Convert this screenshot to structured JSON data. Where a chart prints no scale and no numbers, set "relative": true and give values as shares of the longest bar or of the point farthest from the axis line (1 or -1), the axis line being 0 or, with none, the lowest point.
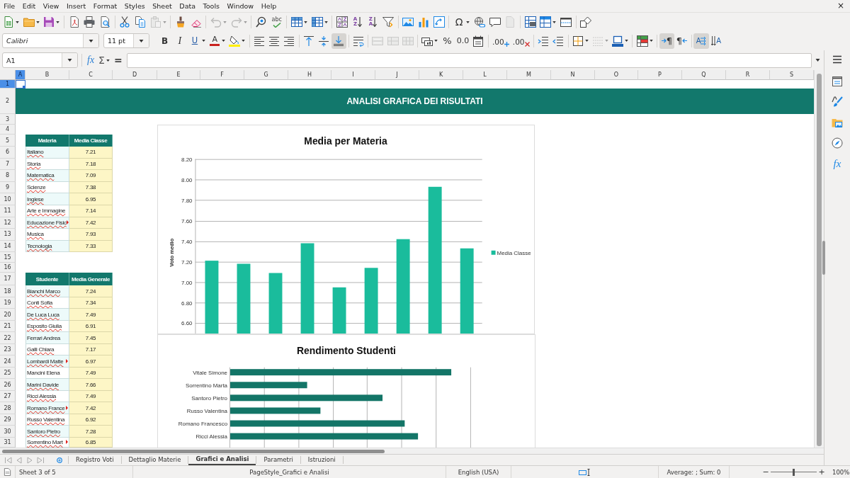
{
  "menu_bar": {
    "items": [
      "File",
      "Edit",
      "View",
      "Insert",
      "Format",
      "Styles",
      "Sheet",
      "Data",
      "Tools",
      "Window",
      "Help"
    ],
    "close": "×"
  },
  "standard_toolbar": {
    "groups": [
      [
        {
          "kind": "new",
          "menu": true,
          "disabled": false
        },
        {
          "kind": "open",
          "menu": true,
          "disabled": false
        },
        {
          "kind": "save",
          "menu": true,
          "disabled": false
        }
      ],
      [
        {
          "kind": "pdf",
          "menu": false,
          "disabled": false
        },
        {
          "kind": "print",
          "menu": false,
          "disabled": false
        },
        {
          "kind": "preview",
          "menu": false,
          "disabled": false
        }
      ],
      [
        {
          "kind": "cut",
          "menu": false,
          "disabled": false
        },
        {
          "kind": "copy",
          "menu": false,
          "disabled": false
        },
        {
          "kind": "paste",
          "menu": true,
          "disabled": true
        }
      ],
      [
        {
          "kind": "clone",
          "menu": false,
          "disabled": false
        },
        {
          "kind": "clear",
          "menu": false,
          "disabled": false
        }
      ],
      [
        {
          "kind": "undo",
          "menu": true,
          "disabled": true
        },
        {
          "kind": "redo",
          "menu": true,
          "disabled": true
        }
      ],
      [
        {
          "kind": "find",
          "menu": false,
          "disabled": false
        },
        {
          "kind": "spelling",
          "text": "abc",
          "menu": false,
          "disabled": false
        }
      ],
      [
        {
          "kind": "rows",
          "menu": true,
          "disabled": false
        },
        {
          "kind": "columns",
          "menu": true,
          "disabled": false
        }
      ],
      [
        {
          "kind": "sort",
          "menu": false,
          "disabled": false
        },
        {
          "kind": "sortup",
          "text": "AZ",
          "menu": false,
          "disabled": false
        },
        {
          "kind": "sortdown",
          "text": "ZA",
          "menu": false,
          "disabled": false
        },
        {
          "kind": "filter",
          "menu": false,
          "disabled": false
        }
      ],
      [
        {
          "kind": "image",
          "menu": false,
          "disabled": false
        },
        {
          "kind": "chart",
          "menu": false,
          "disabled": false
        },
        {
          "kind": "pivot",
          "menu": false,
          "disabled": false
        }
      ],
      [
        {
          "kind": "special",
          "text": "Ω",
          "menu": true,
          "disabled": false
        },
        {
          "kind": "hyperlink",
          "menu": false,
          "disabled": false
        },
        {
          "kind": "comment",
          "menu": false,
          "disabled": false
        },
        {
          "kind": "headerfooter",
          "menu": false,
          "disabled": true
        }
      ],
      [
        {
          "kind": "printarea",
          "menu": false,
          "disabled": false
        },
        {
          "kind": "freeze",
          "menu": true,
          "disabled": false
        },
        {
          "kind": "split",
          "menu": false,
          "disabled": false
        }
      ],
      [
        {
          "kind": "draw",
          "menu": false,
          "disabled": false
        }
      ]
    ]
  },
  "formatting_toolbar": {
    "font_name": "Calibri",
    "font_size": "11 pt",
    "groups": [
      [
        {
          "kind": "bold",
          "text": "B",
          "menu": false,
          "disabled": false,
          "pressed": false
        },
        {
          "kind": "italic",
          "text": "I",
          "menu": false,
          "disabled": false,
          "pressed": false
        },
        {
          "kind": "underline",
          "text": "U",
          "menu": true,
          "disabled": false,
          "pressed": false
        },
        {
          "kind": "fontcolor",
          "text": "A",
          "menu": true,
          "disabled": false,
          "pressed": false
        },
        {
          "kind": "highlight",
          "menu": true,
          "disabled": false,
          "pressed": false
        }
      ],
      [
        {
          "kind": "left",
          "menu": false,
          "disabled": false,
          "pressed": false
        },
        {
          "kind": "center",
          "menu": false,
          "disabled": false,
          "pressed": false
        },
        {
          "kind": "right",
          "menu": false,
          "disabled": false,
          "pressed": false
        }
      ],
      [
        {
          "kind": "top",
          "menu": false,
          "disabled": false,
          "pressed": false
        },
        {
          "kind": "middle",
          "menu": false,
          "disabled": false,
          "pressed": false
        },
        {
          "kind": "bottom",
          "menu": false,
          "disabled": false,
          "pressed": true
        }
      ],
      [
        {
          "kind": "wrap",
          "menu": false,
          "disabled": false,
          "pressed": false
        }
      ],
      [
        {
          "kind": "mergecenter",
          "menu": false,
          "disabled": true,
          "pressed": false
        },
        {
          "kind": "merge",
          "menu": false,
          "disabled": true,
          "pressed": false
        },
        {
          "kind": "unmerge",
          "menu": false,
          "disabled": true,
          "pressed": false
        }
      ],
      [
        {
          "kind": "currency",
          "menu": true,
          "disabled": false,
          "pressed": false
        },
        {
          "kind": "percent",
          "text": "%",
          "menu": false,
          "disabled": false,
          "pressed": false
        },
        {
          "kind": "number",
          "text": "0.0",
          "menu": false,
          "disabled": false,
          "pressed": false
        },
        {
          "kind": "date",
          "menu": false,
          "disabled": false,
          "pressed": false
        }
      ],
      [
        {
          "kind": "adddecimal",
          "text": ".00",
          "menu": false,
          "disabled": false,
          "pressed": false
        },
        {
          "kind": "deldecimal",
          "text": ".00",
          "menu": false,
          "disabled": false,
          "pressed": false
        }
      ],
      [
        {
          "kind": "indent",
          "menu": false,
          "disabled": false,
          "pressed": false
        },
        {
          "kind": "outdent",
          "menu": false,
          "disabled": false,
          "pressed": false
        }
      ],
      [
        {
          "kind": "borders",
          "menu": true,
          "disabled": false,
          "pressed": false
        },
        {
          "kind": "borderstyle",
          "menu": true,
          "disabled": true,
          "pressed": false
        },
        {
          "kind": "bordercolor",
          "menu": true,
          "disabled": false,
          "pressed": false
        }
      ],
      [
        {
          "kind": "conditional",
          "menu": true,
          "disabled": false,
          "pressed": false
        }
      ],
      [
        {
          "kind": "ltr",
          "text": "¶",
          "menu": false,
          "disabled": false,
          "pressed": true
        },
        {
          "kind": "rtl",
          "text": "¶",
          "menu": false,
          "disabled": false,
          "pressed": false
        }
      ],
      [
        {
          "kind": "horizontal",
          "text": "A",
          "menu": false,
          "disabled": false,
          "pressed": true
        },
        {
          "kind": "stacked",
          "text": "A",
          "menu": false,
          "disabled": false,
          "pressed": false
        }
      ]
    ]
  },
  "formula_bar": {
    "name_box": "A1",
    "function_wizard": "fx",
    "sum": "Σ",
    "formula": "="
  },
  "sheet": {
    "columns": [
      {
        "label": "A",
        "selected": true
      },
      {
        "label": "B",
        "selected": false
      },
      {
        "label": "C",
        "selected": false
      },
      {
        "label": "D",
        "selected": false
      },
      {
        "label": "E",
        "selected": false
      },
      {
        "label": "F",
        "selected": false
      },
      {
        "label": "G",
        "selected": false
      },
      {
        "label": "H",
        "selected": false
      },
      {
        "label": "I",
        "selected": false
      },
      {
        "label": "J",
        "selected": false
      },
      {
        "label": "K",
        "selected": false
      },
      {
        "label": "L",
        "selected": false
      },
      {
        "label": "M",
        "selected": false
      },
      {
        "label": "N",
        "selected": false
      },
      {
        "label": "O",
        "selected": false
      },
      {
        "label": "P",
        "selected": false
      },
      {
        "label": "Q",
        "selected": false
      },
      {
        "label": "R",
        "selected": false
      },
      {
        "label": "S",
        "selected": false
      }
    ],
    "rows": [
      {
        "label": "1",
        "selected": true
      },
      {
        "label": "2",
        "selected": false
      },
      {
        "label": "3",
        "selected": false
      },
      {
        "label": "4",
        "selected": false
      },
      {
        "label": "5",
        "selected": false
      },
      {
        "label": "6",
        "selected": false
      },
      {
        "label": "7",
        "selected": false
      },
      {
        "label": "8",
        "selected": false
      },
      {
        "label": "9",
        "selected": false
      },
      {
        "label": "10",
        "selected": false
      },
      {
        "label": "11",
        "selected": false
      },
      {
        "label": "12",
        "selected": false
      },
      {
        "label": "13",
        "selected": false
      },
      {
        "label": "14",
        "selected": false
      },
      {
        "label": "15",
        "selected": false
      },
      {
        "label": "16",
        "selected": false
      },
      {
        "label": "17",
        "selected": false
      },
      {
        "label": "18",
        "selected": false
      },
      {
        "label": "19",
        "selected": false
      },
      {
        "label": "20",
        "selected": false
      },
      {
        "label": "21",
        "selected": false
      },
      {
        "label": "22",
        "selected": false
      },
      {
        "label": "23",
        "selected": false
      },
      {
        "label": "24",
        "selected": false
      },
      {
        "label": "25",
        "selected": false
      },
      {
        "label": "26",
        "selected": false
      },
      {
        "label": "27",
        "selected": false
      },
      {
        "label": "28",
        "selected": false
      },
      {
        "label": "29",
        "selected": false
      },
      {
        "label": "30",
        "selected": false
      },
      {
        "label": "31",
        "selected": false
      }
    ],
    "banner": "ANALISI GRAFICA DEI RISULTATI",
    "subject_table": {
      "columns": [
        "Materia",
        "Media Classe"
      ],
      "rows": [
        {
          "name": "Italiano",
          "value": "7.21",
          "spell_error": true,
          "overflow": false
        },
        {
          "name": "Storia",
          "value": "7.18",
          "spell_error": true,
          "overflow": false
        },
        {
          "name": "Matematica",
          "value": "7.09",
          "spell_error": true,
          "overflow": false
        },
        {
          "name": "Scienze",
          "value": "7.38",
          "spell_error": true,
          "overflow": false
        },
        {
          "name": "Inglese",
          "value": "6.95",
          "spell_error": true,
          "overflow": false
        },
        {
          "name": "Arte e Immagine",
          "value": "7.14",
          "spell_error": true,
          "overflow": false
        },
        {
          "name": "Educazione Fisic",
          "value": "7.42",
          "spell_error": true,
          "overflow": true
        },
        {
          "name": "Musica",
          "value": "7.93",
          "spell_error": true,
          "overflow": false
        },
        {
          "name": "Tecnologia",
          "value": "7.33",
          "spell_error": true,
          "overflow": false
        }
      ]
    },
    "student_table": {
      "columns": [
        "Studente",
        "Media Generale"
      ],
      "rows": [
        {
          "name": "Bianchi Marco",
          "value": "7.24",
          "spell_error": true,
          "overflow": false
        },
        {
          "name": "Conti Sofia",
          "value": "7.34",
          "spell_error": true,
          "overflow": false
        },
        {
          "name": "De Luca Luca",
          "value": "7.49",
          "spell_error": true,
          "overflow": false
        },
        {
          "name": "Esposito Giulia",
          "value": "6.91",
          "spell_error": true,
          "overflow": false
        },
        {
          "name": "Ferrari Andrea",
          "value": "7.45",
          "spell_error": false,
          "overflow": false
        },
        {
          "name": "Galli Chiara",
          "value": "7.17",
          "spell_error": true,
          "overflow": false
        },
        {
          "name": "Lombardi Matte",
          "value": "6.97",
          "spell_error": true,
          "overflow": true
        },
        {
          "name": "Mancini Elena",
          "value": "7.49",
          "spell_error": false,
          "overflow": false
        },
        {
          "name": "Marini Davide",
          "value": "7.66",
          "spell_error": true,
          "overflow": false
        },
        {
          "name": "Ricci Alessia",
          "value": "7.49",
          "spell_error": true,
          "overflow": false
        },
        {
          "name": "Romano France",
          "value": "7.42",
          "spell_error": true,
          "overflow": true
        },
        {
          "name": "Russo Valentina",
          "value": "6.92",
          "spell_error": true,
          "overflow": false
        },
        {
          "name": "Santoro Pietro",
          "value": "7.28",
          "spell_error": true,
          "overflow": false
        },
        {
          "name": "Sorrentino Mart",
          "value": "6.85",
          "spell_error": true,
          "overflow": true
        }
      ]
    }
  },
  "charts": [
    {
      "chart_data": {
        "type": "bar",
        "title": "Media per Materia",
        "ylabel": "Voto medio",
        "grid": true,
        "ylim": [
          6.5,
          8.2
        ],
        "yticks": [
          {
            "value": 6.6,
            "label": "6.60"
          },
          {
            "value": 6.8,
            "label": "6.80"
          },
          {
            "value": 7.0,
            "label": "7.00"
          },
          {
            "value": 7.2,
            "label": "7.20"
          },
          {
            "value": 7.4,
            "label": "7.40"
          },
          {
            "value": 7.6,
            "label": "7.60"
          },
          {
            "value": 7.8,
            "label": "7.80"
          },
          {
            "value": 8.0,
            "label": "8.00"
          },
          {
            "value": 8.2,
            "label": "8.20"
          }
        ],
        "series": [
          {
            "name": "Media Classe",
            "color": "#1abc9c",
            "values": [
              7.21,
              7.18,
              7.09,
              7.38,
              6.95,
              7.14,
              7.42,
              7.93,
              7.33
            ]
          }
        ]
      }
    },
    {
      "chart_data": {
        "type": "bar",
        "orientation": "horizontal",
        "relative": true,
        "grid": true,
        "title": "Rendimento Studenti",
        "categories": [
          "Vitale Simone",
          "Sorrentino Marta",
          "Santoro Pietro",
          "Russo Valentina",
          "Romano Francesco",
          "Ricci Alessia"
        ],
        "series": [
          {
            "color": "#137567",
            "values": [
              1.0,
              0.35,
              0.69,
              0.41,
              0.79,
              0.85
            ]
          }
        ]
      }
    }
  ],
  "sidebar": {
    "buttons": [
      {
        "kind": "menu"
      },
      {
        "kind": "properties"
      },
      {
        "kind": "styles"
      },
      {
        "kind": "gallery"
      },
      {
        "kind": "navigator"
      },
      {
        "kind": "functions",
        "text": "fx"
      }
    ]
  },
  "sheet_tabs": [
    {
      "label": "Registro Voti",
      "selected": false
    },
    {
      "label": "Dettaglio Materie",
      "selected": false
    },
    {
      "label": "Grafici e Analisi",
      "selected": true
    },
    {
      "label": "Parametri",
      "selected": false
    },
    {
      "label": "Istruzioni",
      "selected": false
    }
  ],
  "status_bar": {
    "sheet": "Sheet 3 of 5",
    "page_style": "PageStyle_Grafici e Analisi",
    "language": "English (USA)",
    "summary": "Average: ; Sum: 0",
    "zoom": {
      "minus": "−",
      "plus": "+",
      "level": 0.5,
      "percent": "100%"
    }
  }
}
